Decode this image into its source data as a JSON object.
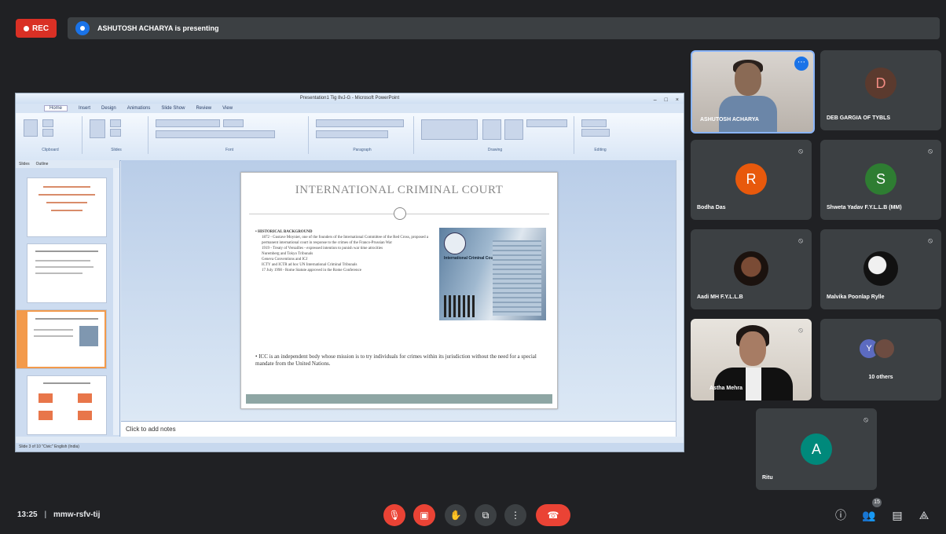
{
  "top": {
    "rec_label": "REC",
    "presenting_text": "ASHUTOSH ACHARYA is presenting"
  },
  "ppt": {
    "window_title": "Presentation1 Tig 8vJ-G - Microsoft PowerPoint",
    "tabs": [
      "Home",
      "Insert",
      "Design",
      "Animations",
      "Slide Show",
      "Review",
      "View"
    ],
    "ribbon_groups": [
      "Clipboard",
      "Slides",
      "Font",
      "Paragraph",
      "Drawing",
      "Editing"
    ],
    "pane_tabs": [
      "Slides",
      "Outline"
    ],
    "notes_placeholder": "Click to add notes",
    "status_text": "Slide 3 of 10   \"Civic\"   English (India)"
  },
  "slide": {
    "title": "INTERNATIONAL CRIMINAL COURT",
    "heading": "HISTORICAL BACKGROUND",
    "lines": [
      "1872 - Gustave Moynier, one of the founders of the International Committee of the Red Cross, proposed a permanent international court in response to the crimes of the Franco-Prussian War",
      "1919 - Treaty of Versailles - expressed intention to punish war time atrocities",
      "Nuremberg and Tokyo Tribunals",
      "Geneva Conventions and ICJ",
      "ICTY and ICTR ad hoc UN International Criminal Tribunals",
      "17 July 1998 - Rome Statute approved in the Rome Conference"
    ],
    "photo_text": "International Criminal Court",
    "paragraph": "ICC is an independent body whose mission is to try individuals for crimes within its jurisdiction without the need for a special mandate from the United Nations."
  },
  "participants": [
    {
      "name": "ASHUTOSH ACHARYA",
      "type": "video"
    },
    {
      "name": "DEB GARGIA OF TYBLS",
      "initial": "D",
      "color": "#5b3a2e",
      "text_color": "#f28b82"
    },
    {
      "name": "Bodha Das",
      "initial": "R",
      "color": "#e8590c"
    },
    {
      "name": "Shweta Yadav F.Y.L.L.B (MM)",
      "initial": "S",
      "color": "#2e7d32"
    },
    {
      "name": "Aadi MH F.Y.L.L.B",
      "type": "photo"
    },
    {
      "name": "Malvika Poonlap Rylle",
      "type": "photo"
    },
    {
      "name": "Astha Mehra",
      "type": "video"
    },
    {
      "name": "10 others",
      "stack_initial": "Y"
    },
    {
      "name": "Ritu",
      "initial": "A",
      "color": "#00897b"
    }
  ],
  "bottom": {
    "time": "13:25",
    "meeting_code": "mmw-rsfv-tij",
    "people_count": "15"
  }
}
